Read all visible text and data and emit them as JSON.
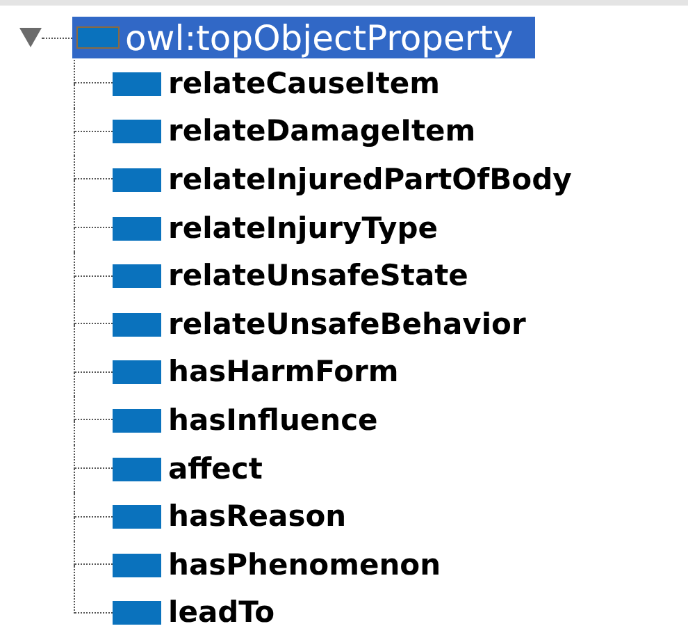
{
  "tree": {
    "label": "owl:topObjectProperty",
    "selected": true,
    "expanded": true,
    "children": [
      {
        "label": "relateCauseItem",
        "selected": false
      },
      {
        "label": "relateDamageItem",
        "selected": false
      },
      {
        "label": "relateInjuredPartOfBody",
        "selected": false
      },
      {
        "label": "relateInjuryType",
        "selected": false
      },
      {
        "label": "relateUnsafeState",
        "selected": false
      },
      {
        "label": "relateUnsafeBehavior",
        "selected": false
      },
      {
        "label": "hasHarmForm",
        "selected": false
      },
      {
        "label": "hasInfluence",
        "selected": false
      },
      {
        "label": "affect",
        "selected": false
      },
      {
        "label": "hasReason",
        "selected": false
      },
      {
        "label": "hasPhenomenon",
        "selected": false
      },
      {
        "label": "leadTo",
        "selected": false
      }
    ]
  }
}
